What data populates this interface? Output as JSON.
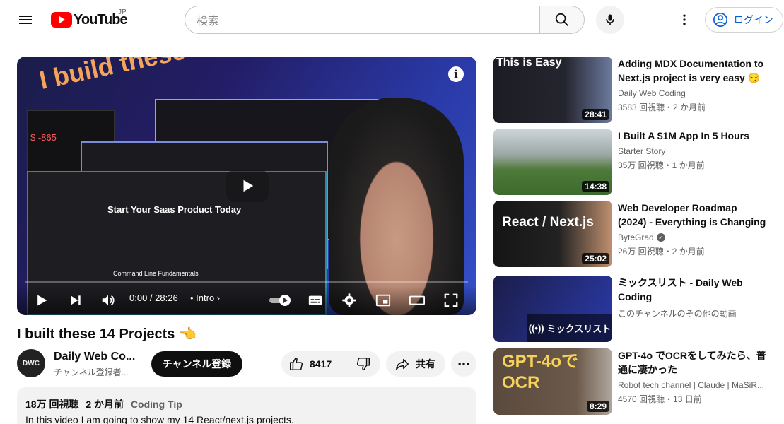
{
  "header": {
    "logo_text": "YouTube",
    "region": "JP",
    "search_placeholder": "検索",
    "login_label": "ログイン"
  },
  "player": {
    "thumbnail_headline": "I build these",
    "screen_money": "$ -865",
    "screen_title": "Start Your Saas Product  Today",
    "screen_section": "Command Line Fundamentals",
    "time_display": "0:00 / 28:26",
    "chapter": "Intro",
    "progress_fraction": 0.0
  },
  "video": {
    "title": "I built these 14 Projects 👈",
    "channel_name": "Daily Web Co...",
    "channel_avatar_text": "DWC",
    "subscribers": "チャンネル登録者...",
    "subscribe_label": "チャンネル登録",
    "like_count": "8417",
    "share_label": "共有",
    "views": "18万 回視聴",
    "date": "2 か月前",
    "tag": "Coding Tip",
    "description": "In this video I am going to show my 14 React/next.js projects."
  },
  "recommendations": [
    {
      "title": "Adding MDX Documentation to Next.js project is very easy 😏",
      "channel": "Daily Web Coding",
      "stats": "3583 回視聴・2 か月前",
      "duration": "28:41",
      "thumb_text": "This is Easy",
      "verified": false
    },
    {
      "title": "I Built A $1M App In 5 Hours",
      "channel": "Starter Story",
      "stats": "35万 回視聴・1 か月前",
      "duration": "14:38",
      "thumb_text": "",
      "verified": false
    },
    {
      "title": "Web Developer Roadmap (2024) - Everything is Changing",
      "channel": "ByteGrad",
      "stats": "26万 回視聴・2 か月前",
      "duration": "25:02",
      "thumb_text": "React / Next.js",
      "verified": true
    },
    {
      "title": "ミックスリスト - Daily Web Coding",
      "channel": "このチャンネルのその他の動画",
      "stats": "",
      "duration": "",
      "thumb_text": "ミックスリスト",
      "verified": false
    },
    {
      "title": "GPT-4o でOCRをしてみたら、普通に凄かった",
      "channel": "Robot tech channel | Claude | MaSiR...",
      "stats": "4570 回視聴・13 日前",
      "duration": "8:29",
      "thumb_text": "GPT-4oで OCR",
      "verified": false
    }
  ],
  "colors": {
    "brand_red": "#ff0000",
    "link_blue": "#065fd4",
    "text_primary": "#0f0f0f",
    "text_secondary": "#606060"
  }
}
